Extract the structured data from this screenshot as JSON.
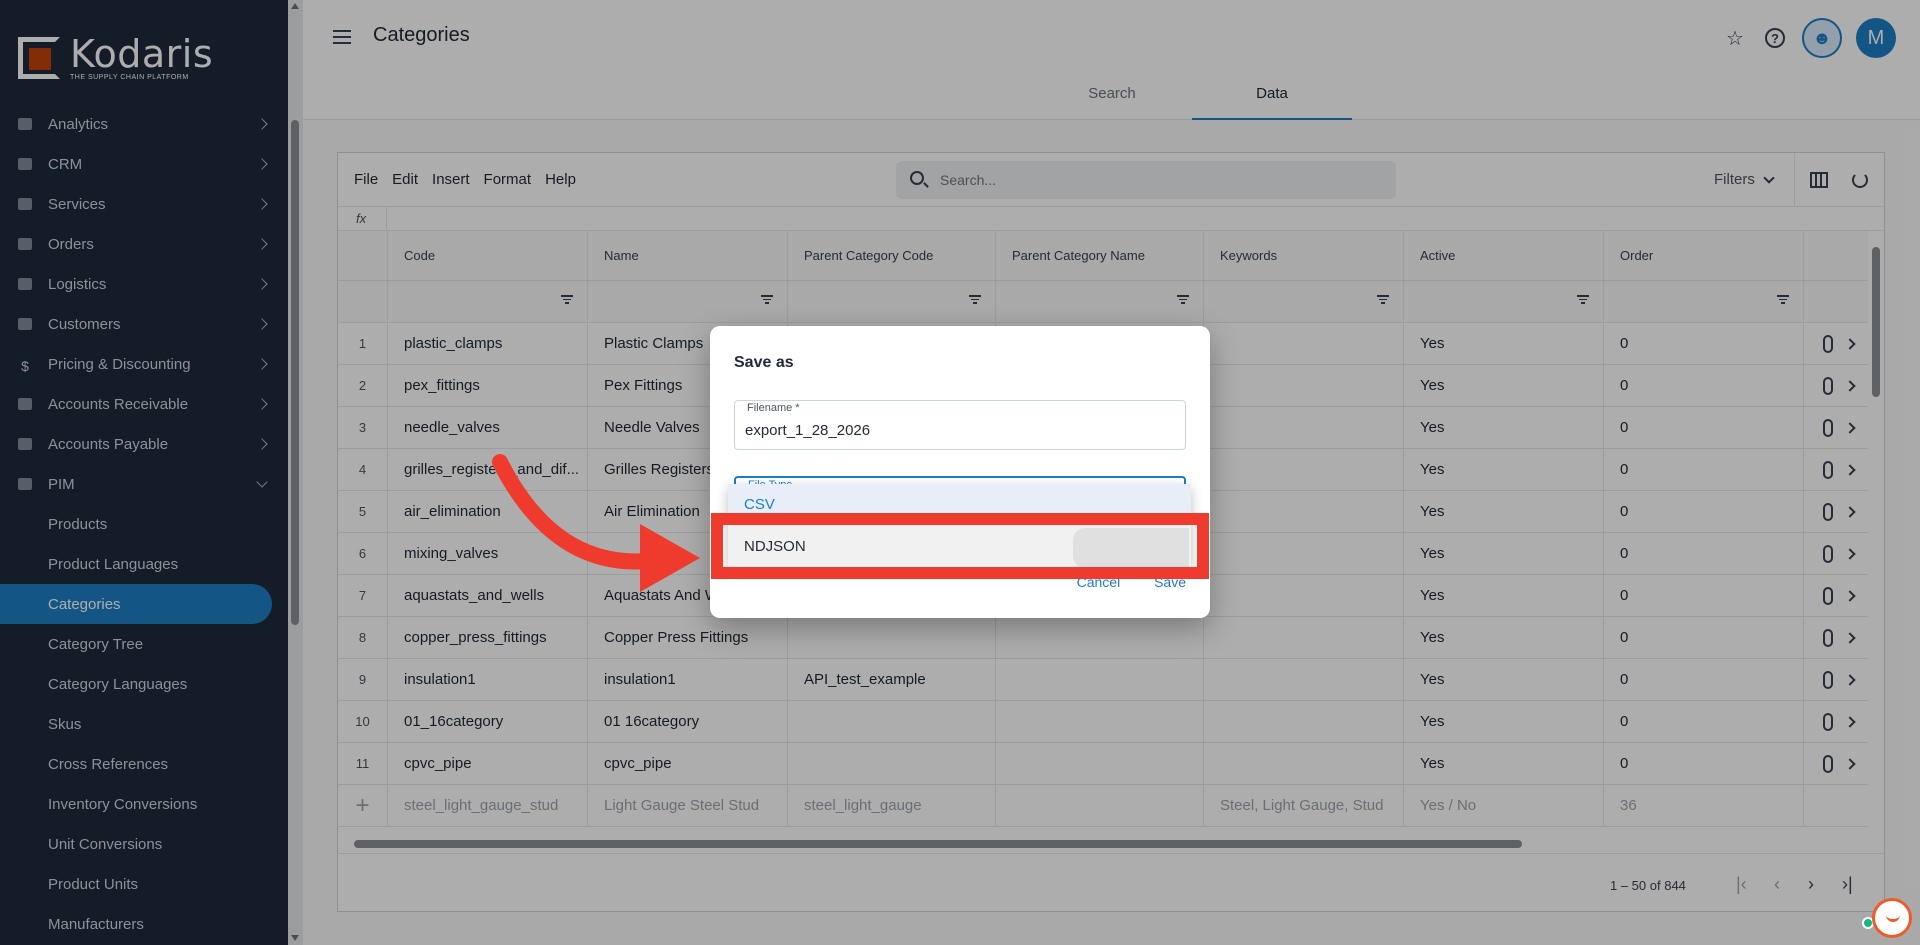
{
  "brand": {
    "name": "Kodaris",
    "tagline": "THE SUPPLY CHAIN PLATFORM"
  },
  "sidebar": {
    "items": [
      {
        "label": "Analytics"
      },
      {
        "label": "CRM"
      },
      {
        "label": "Services"
      },
      {
        "label": "Orders"
      },
      {
        "label": "Logistics"
      },
      {
        "label": "Customers"
      },
      {
        "label": "Pricing & Discounting"
      },
      {
        "label": "Accounts Receivable"
      },
      {
        "label": "Accounts Payable"
      },
      {
        "label": "PIM"
      }
    ],
    "pim_sub": [
      {
        "label": "Products"
      },
      {
        "label": "Product Languages"
      },
      {
        "label": "Categories"
      },
      {
        "label": "Category Tree"
      },
      {
        "label": "Category Languages"
      },
      {
        "label": "Skus"
      },
      {
        "label": "Cross References"
      },
      {
        "label": "Inventory Conversions"
      },
      {
        "label": "Unit Conversions"
      },
      {
        "label": "Product Units"
      },
      {
        "label": "Manufacturers"
      }
    ]
  },
  "header": {
    "title": "Categories",
    "avatar_initial": "M"
  },
  "tabs": [
    {
      "label": "Search"
    },
    {
      "label": "Data"
    }
  ],
  "toolbar": {
    "menu": [
      "File",
      "Edit",
      "Insert",
      "Format",
      "Help"
    ],
    "search_placeholder": "Search...",
    "filters_label": "Filters",
    "fx_label": "fx"
  },
  "table": {
    "columns": [
      "Code",
      "Name",
      "Parent Category Code",
      "Parent Category Name",
      "Keywords",
      "Active",
      "Order"
    ],
    "rows": [
      {
        "num": "1",
        "code": "plastic_clamps",
        "name": "Plastic Clamps",
        "parent_code": "",
        "parent_name": "",
        "keywords": "",
        "active": "Yes",
        "order": "0"
      },
      {
        "num": "2",
        "code": "pex_fittings",
        "name": "Pex Fittings",
        "parent_code": "",
        "parent_name": "",
        "keywords": "",
        "active": "Yes",
        "order": "0"
      },
      {
        "num": "3",
        "code": "needle_valves",
        "name": "Needle Valves",
        "parent_code": "",
        "parent_name": "",
        "keywords": "",
        "active": "Yes",
        "order": "0"
      },
      {
        "num": "4",
        "code": "grilles_registers_and_dif...",
        "name": "Grilles Registers",
        "parent_code": "",
        "parent_name": "",
        "keywords": "",
        "active": "Yes",
        "order": "0"
      },
      {
        "num": "5",
        "code": "air_elimination",
        "name": "Air Elimination",
        "parent_code": "",
        "parent_name": "",
        "keywords": "",
        "active": "Yes",
        "order": "0"
      },
      {
        "num": "6",
        "code": "mixing_valves",
        "name": "",
        "parent_code": "",
        "parent_name": "",
        "keywords": "",
        "active": "Yes",
        "order": "0"
      },
      {
        "num": "7",
        "code": "aquastats_and_wells",
        "name": "Aquastats And W",
        "parent_code": "",
        "parent_name": "",
        "keywords": "",
        "active": "Yes",
        "order": "0"
      },
      {
        "num": "8",
        "code": "copper_press_fittings",
        "name": "Copper Press Fittings",
        "parent_code": "",
        "parent_name": "",
        "keywords": "",
        "active": "Yes",
        "order": "0"
      },
      {
        "num": "9",
        "code": "insulation1",
        "name": "insulation1",
        "parent_code": "API_test_example",
        "parent_name": "",
        "keywords": "",
        "active": "Yes",
        "order": "0"
      },
      {
        "num": "10",
        "code": "01_16category",
        "name": "01 16category",
        "parent_code": "",
        "parent_name": "",
        "keywords": "",
        "active": "Yes",
        "order": "0"
      },
      {
        "num": "11",
        "code": "cpvc_pipe",
        "name": "cpvc_pipe",
        "parent_code": "",
        "parent_name": "",
        "keywords": "",
        "active": "Yes",
        "order": "0"
      }
    ],
    "new_row": {
      "plus": "+",
      "code": "steel_light_gauge_stud",
      "name": "Light Gauge Steel Stud",
      "parent_code": "steel_light_gauge",
      "parent_name": "",
      "keywords": "Steel, Light Gauge, Stud",
      "active": "Yes / No",
      "order": "36"
    },
    "pagination": "1 – 50 of 844"
  },
  "dialog": {
    "title": "Save as",
    "filename_label": "Filename *",
    "filename_value": "export_1_28_2026",
    "filetype_label": "File Type",
    "options": [
      "CSV",
      "NDJSON"
    ],
    "selected_option": "CSV",
    "cancel_label": "Cancel",
    "save_label": "Save"
  },
  "colors": {
    "sidebar_bg": "#1e2a3a",
    "accent": "#1d7fc4",
    "highlight": "#ef3b2d",
    "brand_orange": "#c2410c"
  },
  "icons": [
    "hamburger-icon",
    "star-icon",
    "help-icon",
    "bot-icon",
    "search-icon",
    "chevron-down-icon",
    "columns-icon",
    "refresh-icon",
    "filter-icon",
    "attachment-icon",
    "chevron-right-icon",
    "chat-icon"
  ]
}
